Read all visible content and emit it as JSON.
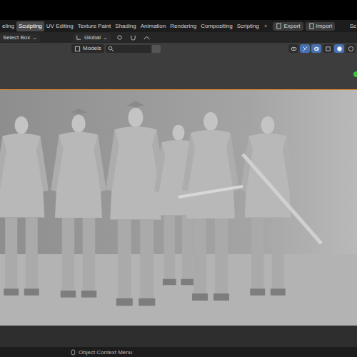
{
  "workspace_tabs": [
    {
      "label": "eling",
      "selected": false
    },
    {
      "label": "Sculpting",
      "selected": true
    },
    {
      "label": "UV Editing",
      "selected": false
    },
    {
      "label": "Texture Paint",
      "selected": false
    },
    {
      "label": "Shading",
      "selected": false
    },
    {
      "label": "Animation",
      "selected": false
    },
    {
      "label": "Rendering",
      "selected": false
    },
    {
      "label": "Compositing",
      "selected": false
    },
    {
      "label": "Scripting",
      "selected": false
    }
  ],
  "add_tab": "+",
  "header_buttons": [
    "Export",
    "Import"
  ],
  "scene_selector": "Sc",
  "tool_header": {
    "tool_dropdown": "Select Box",
    "orientation": "Global"
  },
  "viewport_header": {
    "collection_dropdown": "Models"
  },
  "status_bar": {
    "hint": "Object Context Menu"
  }
}
